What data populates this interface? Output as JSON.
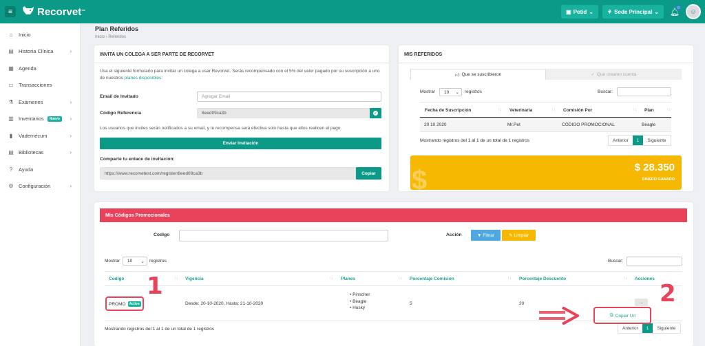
{
  "header": {
    "brand": "Recorvet",
    "brand_tm": "™",
    "pet_menu": "Petid",
    "branch_menu": "Sede Principal",
    "notification_count": "0"
  },
  "sidebar": {
    "items": [
      {
        "label": "Inicio",
        "icon": "home-icon"
      },
      {
        "label": "Historia Clínica",
        "icon": "record-icon"
      },
      {
        "label": "Agenda",
        "icon": "calendar-icon"
      },
      {
        "label": "Transacciones",
        "icon": "money-icon"
      },
      {
        "label": "Exámenes",
        "icon": "flask-icon"
      },
      {
        "label": "Inventarios",
        "icon": "box-icon",
        "badge": "Nuevo"
      },
      {
        "label": "Vademécum",
        "icon": "book-icon"
      },
      {
        "label": "Bibliotecas",
        "icon": "library-icon"
      },
      {
        "label": "Ayuda",
        "icon": "help-icon"
      },
      {
        "label": "Configuración",
        "icon": "gear-icon"
      }
    ]
  },
  "page": {
    "title": "Plan Referidos",
    "breadcrumb_home": "Inicio",
    "breadcrumb_sep": "›",
    "breadcrumb_current": "Referidos"
  },
  "invite": {
    "title": "INVITA UN COLEGA A SER PARTE DE RECORVET",
    "intro": "Usa el siguiente formulario para invitar un colega a usar Revorvet. Serás recompensado con el 5% del valor pagado por su suscripción a uno de nuestros",
    "intro_link": "planes disponibles",
    "intro_end": ":",
    "email_label": "Email de Invitado",
    "email_placeholder": "Agregar Email",
    "code_label": "Código Referencia",
    "code_value": "8eed09ca3b",
    "note": "Los usuarios que invites serán notificados a su email, y tu recompensa será efectiva solo hasta que ellos realicen el pago.",
    "send_button": "Enviar Invitación",
    "share_label": "Comparte tu enlace de invitación:",
    "share_url": "https://www.recorvetest.com/register/8eed09ca3b",
    "copy_button": "Copiar"
  },
  "referrals": {
    "title": "MIS REFERIDOS",
    "tab_active": "Que se suscribieron",
    "tab_inactive": "Que crearon cuenta",
    "show_label": "Mostrar",
    "show_value": "10",
    "records_label": "registros",
    "search_label": "Buscar:",
    "columns": [
      "Fecha de Suscripción",
      "Veterinaria",
      "Comisión Por",
      "Plan"
    ],
    "rows": [
      [
        "20 10 2020",
        "Mr.Pet",
        "CÓDIGO PROMOCIONAL",
        "Beagle"
      ]
    ],
    "footer": "Mostrando registros del 1 al 1 de un total de 1 registros",
    "prev": "Anterior",
    "page": "1",
    "next": "Siguiente"
  },
  "earnings": {
    "amount": "$ 28.350",
    "label": "DINERO GANADO"
  },
  "promo": {
    "title": "Mis Códigos Promocionales",
    "code_label": "Codigo",
    "action_label": "Acción",
    "filter_button": "Filtrar",
    "clear_button": "Limpiar",
    "show_label": "Mostrar",
    "show_value": "10",
    "records_label": "registros",
    "search_label": "Buscar:",
    "columns": [
      "Codigo",
      "Vigencia",
      "Planes",
      "Porcentaje Comision",
      "Porcentaje Descuento",
      "Acciones"
    ],
    "row": {
      "code": "PROMO",
      "status": "Activo",
      "validity": "Desde: 20-10-2020, Hasta: 21-10-2020",
      "plans": [
        "Pinscher",
        "Beagle",
        "Husky"
      ],
      "commission": "5",
      "discount": "20",
      "actions_button": "...",
      "copy_url": "Copiar Url"
    },
    "footer": "Mostrando registros del 1 al 1 de un total de 1 registros",
    "prev": "Anterior",
    "page": "1",
    "next": "Siguiente"
  },
  "annotations": {
    "one": "1",
    "two": "2"
  },
  "colors": {
    "teal": "#0c9a88",
    "red": "#e8435a",
    "yellow": "#f6b800",
    "blue": "#4fa8e0"
  }
}
